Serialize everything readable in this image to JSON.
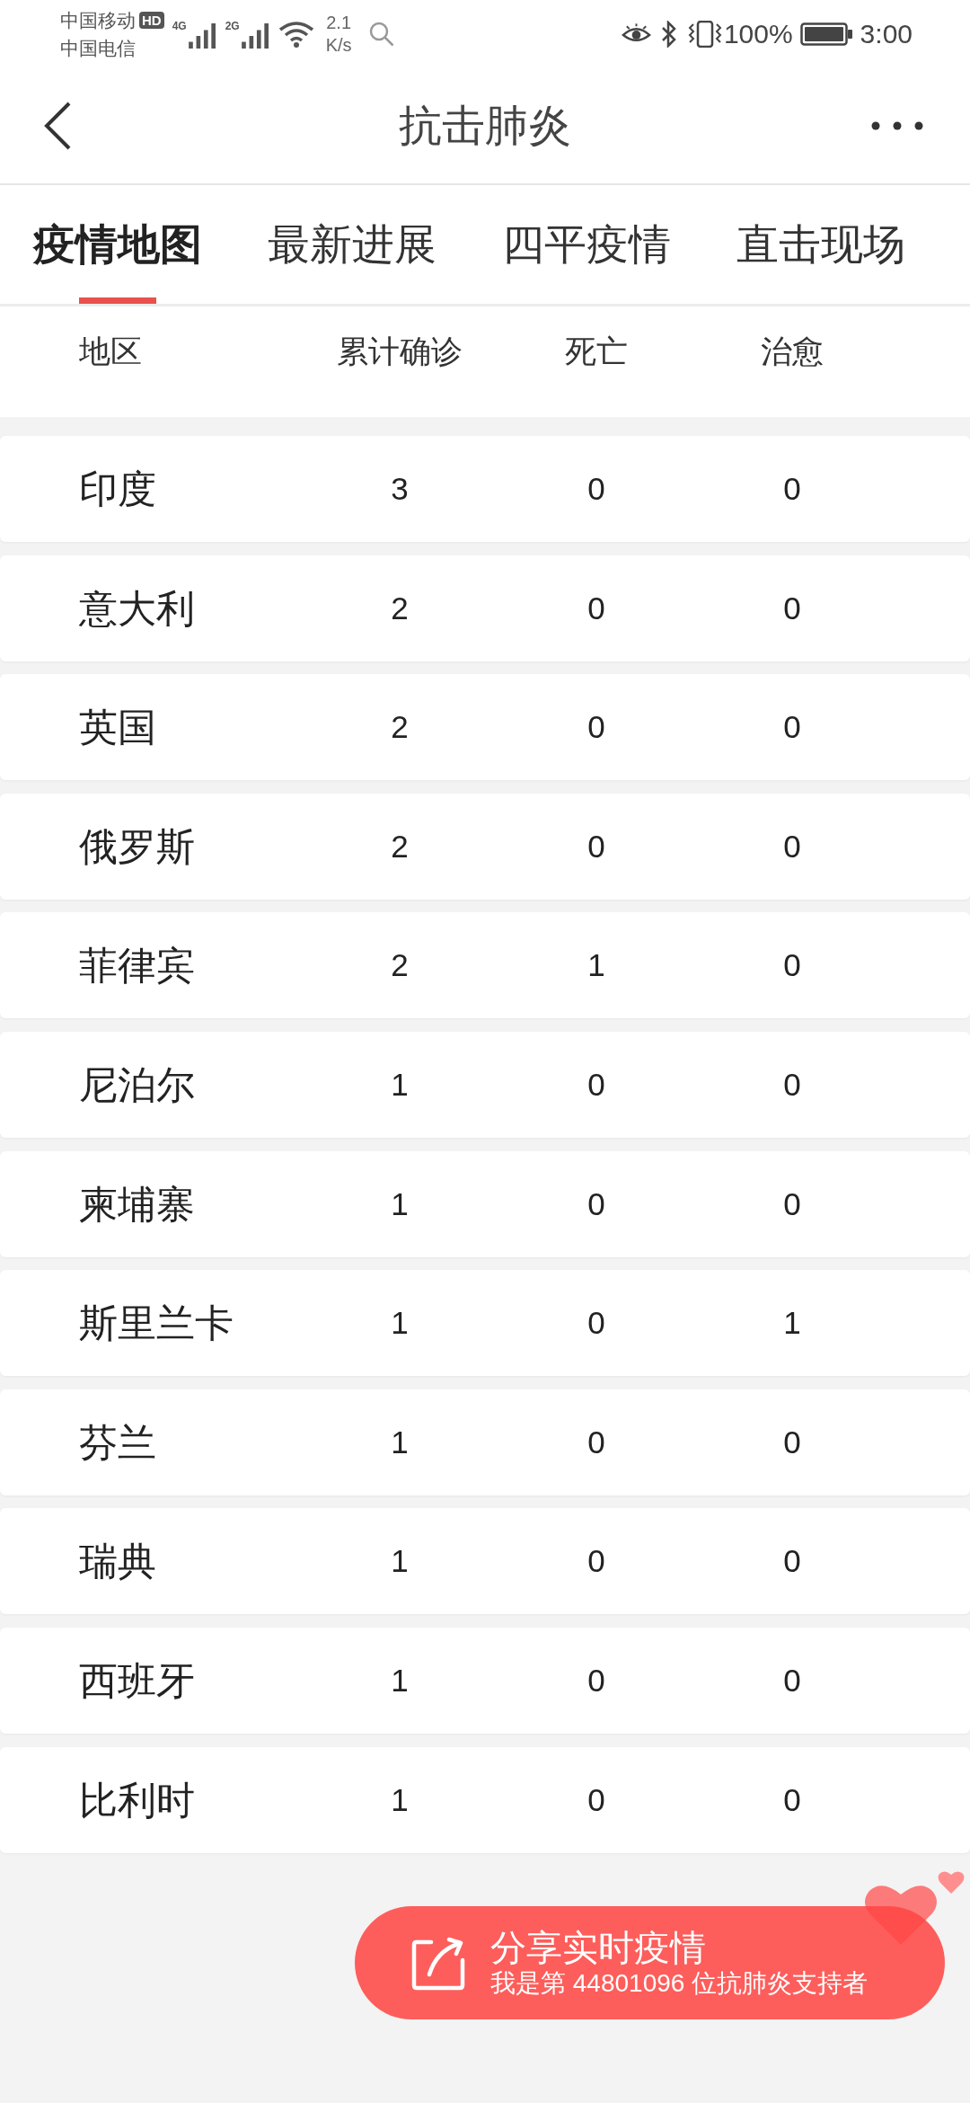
{
  "status_bar": {
    "carrier_1": "中国移动",
    "hd_badge": "HD",
    "carrier_2": "中国电信",
    "network_1": "4G",
    "network_2": "2G",
    "speed_value": "2.1",
    "speed_unit": "K/s",
    "battery_percent": "100%",
    "time": "3:00"
  },
  "header": {
    "title": "抗击肺炎"
  },
  "tabs": [
    {
      "label": "疫情地图",
      "selected": true
    },
    {
      "label": "最新进展",
      "selected": false
    },
    {
      "label": "四平疫情",
      "selected": false
    },
    {
      "label": "直击现场",
      "selected": false
    }
  ],
  "table": {
    "columns": [
      "地区",
      "累计确诊",
      "死亡",
      "治愈"
    ],
    "rows": [
      {
        "region": "印度",
        "confirmed": "3",
        "deaths": "0",
        "cured": "0"
      },
      {
        "region": "意大利",
        "confirmed": "2",
        "deaths": "0",
        "cured": "0"
      },
      {
        "region": "英国",
        "confirmed": "2",
        "deaths": "0",
        "cured": "0"
      },
      {
        "region": "俄罗斯",
        "confirmed": "2",
        "deaths": "0",
        "cured": "0"
      },
      {
        "region": "菲律宾",
        "confirmed": "2",
        "deaths": "1",
        "cured": "0"
      },
      {
        "region": "尼泊尔",
        "confirmed": "1",
        "deaths": "0",
        "cured": "0"
      },
      {
        "region": "柬埔寨",
        "confirmed": "1",
        "deaths": "0",
        "cured": "0"
      },
      {
        "region": "斯里兰卡",
        "confirmed": "1",
        "deaths": "0",
        "cured": "1"
      },
      {
        "region": "芬兰",
        "confirmed": "1",
        "deaths": "0",
        "cured": "0"
      },
      {
        "region": "瑞典",
        "confirmed": "1",
        "deaths": "0",
        "cured": "0"
      },
      {
        "region": "西班牙",
        "confirmed": "1",
        "deaths": "0",
        "cured": "0"
      },
      {
        "region": "比利时",
        "confirmed": "1",
        "deaths": "0",
        "cured": "0"
      }
    ]
  },
  "share_button": {
    "title": "分享实时疫情",
    "subtitle": "我是第 44801096 位抗肺炎支持者"
  }
}
